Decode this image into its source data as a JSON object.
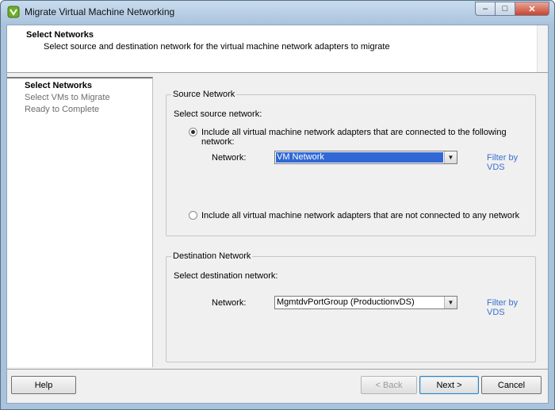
{
  "window": {
    "title": "Migrate Virtual Machine Networking",
    "controls": {
      "minimize": "–",
      "maximize": "□",
      "close": "✕"
    }
  },
  "header": {
    "title": "Select Networks",
    "subtitle": "Select source and destination network for the virtual machine network adapters to migrate"
  },
  "steps": [
    {
      "label": "Select Networks",
      "state": "current"
    },
    {
      "label": "Select VMs to Migrate",
      "state": "pending"
    },
    {
      "label": "Ready to Complete",
      "state": "pending"
    }
  ],
  "source": {
    "legend": "Source Network",
    "prompt": "Select source network:",
    "option_connected": "Include all virtual machine network adapters that are connected to the following network:",
    "option_unconnected": "Include all virtual machine network adapters that are not connected to any network",
    "selected_option": "connected",
    "network_label": "Network:",
    "network_value": "VM Network",
    "filter_link": "Filter by VDS"
  },
  "destination": {
    "legend": "Destination Network",
    "prompt": "Select destination network:",
    "network_label": "Network:",
    "network_value": "MgmtdvPortGroup (ProductionvDS)",
    "filter_link": "Filter by VDS"
  },
  "footer": {
    "help": "Help",
    "back": "< Back",
    "next": "Next >",
    "cancel": "Cancel"
  },
  "colors": {
    "selection": "#3168d5",
    "link": "#3a6fd1",
    "titlebar": "#a9c3dc",
    "close_button": "#c8452f"
  }
}
